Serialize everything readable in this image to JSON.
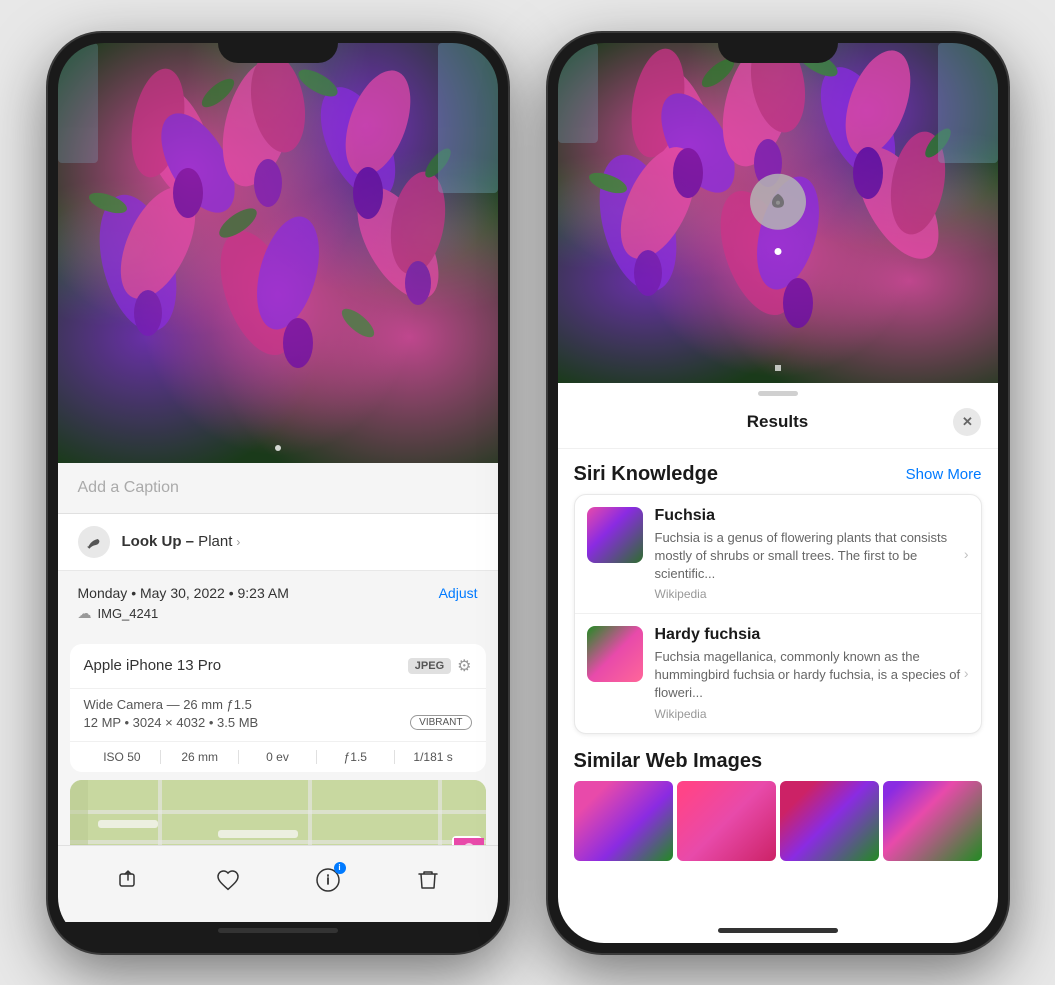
{
  "left_phone": {
    "caption_placeholder": "Add a Caption",
    "lookup": {
      "label": "Look Up –",
      "subject": " Plant",
      "chevron": "›"
    },
    "date": {
      "line1": "Monday • May 30, 2022 • 9:23 AM",
      "adjust": "Adjust",
      "filename": "IMG_4241"
    },
    "device": {
      "name": "Apple iPhone 13 Pro",
      "format": "JPEG",
      "camera": "Wide Camera — 26 mm ƒ1.5",
      "resolution": "12 MP • 3024 × 4032 • 3.5 MB",
      "filter": "VIBRANT",
      "exif": {
        "iso": "ISO 50",
        "focal": "26 mm",
        "ev": "0 ev",
        "aperture": "ƒ1.5",
        "shutter": "1/181 s"
      }
    },
    "toolbar": {
      "share": "⬆",
      "heart": "♡",
      "info": "ⓘ",
      "trash": "🗑"
    }
  },
  "right_phone": {
    "header": {
      "title": "Results",
      "close": "✕"
    },
    "siri_knowledge": {
      "section": "Siri Knowledge",
      "show_more": "Show More",
      "items": [
        {
          "title": "Fuchsia",
          "description": "Fuchsia is a genus of flowering plants that consists mostly of shrubs or small trees. The first to be scientific...",
          "source": "Wikipedia"
        },
        {
          "title": "Hardy fuchsia",
          "description": "Fuchsia magellanica, commonly known as the hummingbird fuchsia or hardy fuchsia, is a species of floweri...",
          "source": "Wikipedia"
        }
      ]
    },
    "similar": {
      "title": "Similar Web Images"
    }
  }
}
